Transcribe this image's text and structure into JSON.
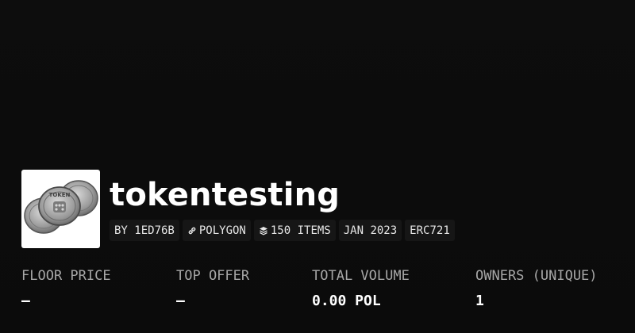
{
  "collection": {
    "name": "tokentesting",
    "avatar_icon": "coin-stack-icon",
    "avatar_text": "TOKEN"
  },
  "tags": {
    "creator": "BY 1ED76B",
    "chain": "POLYGON",
    "chain_icon": "link-icon",
    "items": "150 ITEMS",
    "items_icon": "layers-icon",
    "date": "JAN 2023",
    "standard": "ERC721"
  },
  "stats": {
    "floor_price": {
      "label": "FLOOR PRICE",
      "value": "—"
    },
    "top_offer": {
      "label": "TOP OFFER",
      "value": "—"
    },
    "total_volume": {
      "label": "TOTAL VOLUME",
      "value": "0.00 POL"
    },
    "owners": {
      "label": "OWNERS (UNIQUE)",
      "value": "1"
    }
  },
  "colors": {
    "background": "#0b0b0b",
    "tag_background": "#161616",
    "label": "#a7a7a7",
    "text": "#ffffff"
  }
}
